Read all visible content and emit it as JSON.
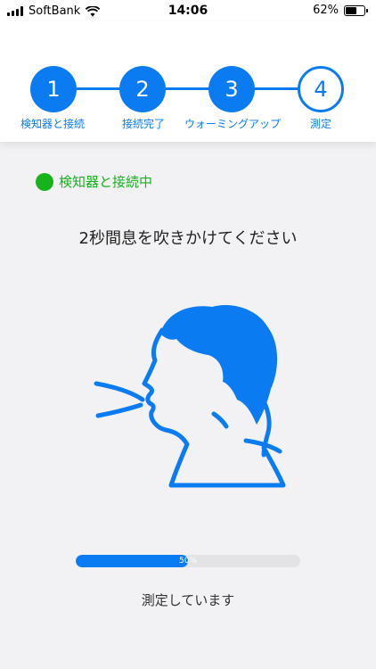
{
  "status_bar": {
    "carrier": "SoftBank",
    "time": "14:06",
    "battery_percent": "62%",
    "battery_level": 0.62
  },
  "stepper": {
    "steps": [
      {
        "number": "1",
        "label": "検知器と接続",
        "state": "done"
      },
      {
        "number": "2",
        "label": "接続完了",
        "state": "done"
      },
      {
        "number": "3",
        "label": "ウォーミングアップ",
        "state": "done"
      },
      {
        "number": "4",
        "label": "測定",
        "state": "current"
      }
    ]
  },
  "connection": {
    "label": "検知器と接続中",
    "color": "#18b21c"
  },
  "instruction": "2秒間息を吹きかけてください",
  "illustration": {
    "icon": "person-blowing-icon",
    "color": "#0b7bf2"
  },
  "progress": {
    "value": 0.5,
    "label": "50%"
  },
  "status_message": "測定しています",
  "colors": {
    "accent": "#0b7bf2",
    "success": "#18b21c",
    "background": "#f2f2f4"
  }
}
